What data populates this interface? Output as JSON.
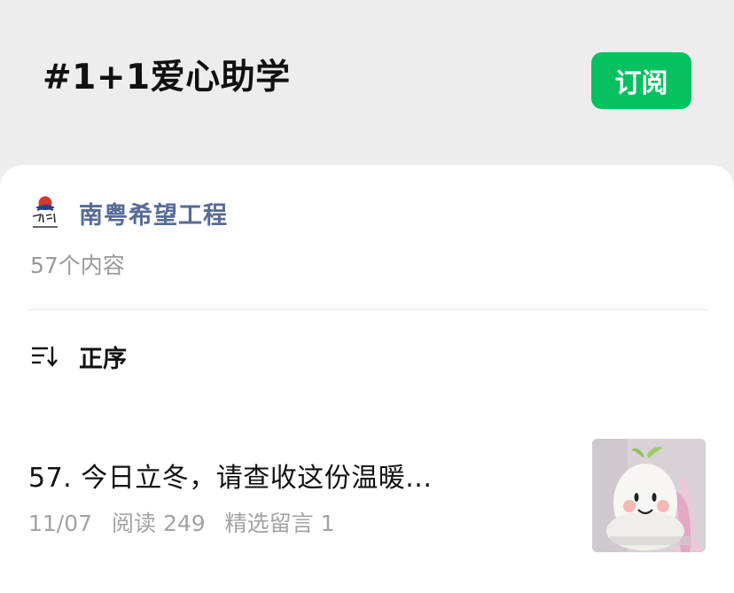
{
  "header": {
    "hashtag_title": "#1+1爱心助学",
    "subscribe_label": "订阅"
  },
  "account": {
    "name": "南粤希望工程",
    "content_count": "57个内容"
  },
  "sort": {
    "label": "正序"
  },
  "articles": [
    {
      "title": "57. 今日立冬，请查收这份温暖...",
      "date": "11/07",
      "reads": "阅读 249",
      "comments": "精选留言 1"
    }
  ],
  "colors": {
    "accent": "#07c160",
    "account_name": "#576b95",
    "background": "#ededed",
    "meta_text": "#a3a3a3"
  },
  "icons": {
    "sort": "sort-order-icon",
    "account_logo": "project-hope-logo",
    "thumbnail": "article-thumbnail"
  }
}
